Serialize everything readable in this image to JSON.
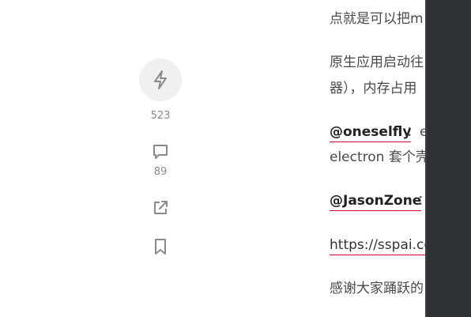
{
  "actions": {
    "like_count": "523",
    "comment_count": "89",
    "like_icon": "lightning-bolt-icon",
    "comment_icon": "comment-bubble-icon",
    "share_icon": "external-share-icon",
    "bookmark_icon": "bookmark-icon"
  },
  "article": {
    "line1": "点就是可以把m",
    "line2": "原生应用启动往",
    "line3": "器），内存占用",
    "mention1_name": "@oneselfly",
    "mention1_rest": "：e",
    "line4": "electron 套个壳",
    "mention2_name": "@JasonZone",
    "mention2_rest": "：",
    "link_text": "https://sspai.co",
    "line5": "感谢大家踊跃的"
  },
  "colors": {
    "accent_underline": "#d6002f",
    "side_panel": "#303134",
    "icon_gray": "#8a8a8a"
  }
}
